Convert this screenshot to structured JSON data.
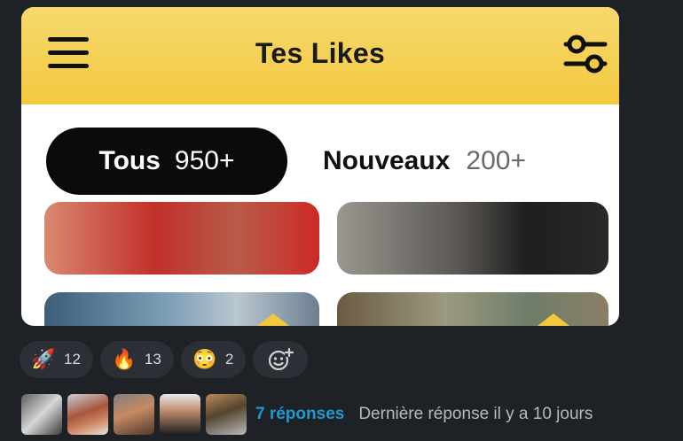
{
  "app": {
    "title": "Tes Likes",
    "tabs": [
      {
        "label": "Tous",
        "count": "950+",
        "active": true
      },
      {
        "label": "Nouveaux",
        "count": "200+",
        "active": false
      }
    ],
    "accent": "#f3c93f"
  },
  "reactions": [
    {
      "emoji": "🚀",
      "icon": "rocket-icon",
      "count": "12"
    },
    {
      "emoji": "🔥",
      "icon": "fire-icon",
      "count": "13"
    },
    {
      "emoji": "😳",
      "icon": "flushed-face-icon",
      "count": "2"
    }
  ],
  "add_reaction_icon": "add-reaction-icon",
  "thread": {
    "replies": "7 réponses",
    "last_reply": "Dernière réponse il y a 10 jours",
    "link_color": "#1d9bd1"
  }
}
